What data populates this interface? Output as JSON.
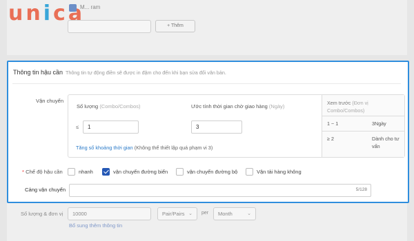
{
  "logo": {
    "text": "unica"
  },
  "background": {
    "checkbox_label": "M... ram",
    "add_button": "+ Thêm",
    "quantity_label": "Số lượng & đơn vị",
    "quantity_value": "10000",
    "unit_value": "Pair/Pairs",
    "per_label": "per",
    "period_value": "Month",
    "more_info_link": "Bổ sung thêm thông tin"
  },
  "panel": {
    "title": "Thông tin hậu cần",
    "subtitle": "Thông tin tự động điền sẽ được in đậm cho đến khi bạn sửa đổi văn bản.",
    "shipping": {
      "label": "Vận chuyển",
      "qty_header": "Số lượng",
      "qty_hint": "(Combo/Combos)",
      "time_header": "Ước tính thời gian chờ giao hàng",
      "time_hint": "(Ngày)",
      "le_symbol": "≤",
      "qty_value": "1",
      "time_value": "3",
      "add_range_link": "Tăng số khoảng thời gian",
      "add_range_note": "(Không thể thiết lập quá phạm vi 3)",
      "preview": {
        "title": "Xem trước",
        "unit_hint": "(Đơn vị Combo/Combos)",
        "rows": [
          {
            "range": "1 ~ 1",
            "days": "3Ngày"
          },
          {
            "range": "≥ 2",
            "days": "Dành cho tư vấn"
          }
        ]
      }
    },
    "mode": {
      "label": "Chế độ hậu cần",
      "required_mark": "*",
      "options": [
        {
          "label": "nhanh",
          "checked": false
        },
        {
          "label": "vận chuyển đường biển",
          "checked": true
        },
        {
          "label": "vận chuyển đường bộ",
          "checked": false
        },
        {
          "label": "Vận tải hàng không",
          "checked": false
        }
      ]
    },
    "port": {
      "label": "Cảng vận chuyển",
      "value": "",
      "counter": "5/128"
    }
  },
  "colors": {
    "accent": "#2e8ddd",
    "checkbox_on": "#2558b5",
    "link": "#2a7ac8",
    "required": "#ee3333"
  }
}
